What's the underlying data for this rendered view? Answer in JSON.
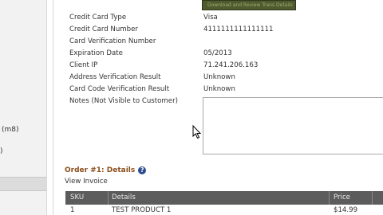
{
  "sidebar": {
    "items": [
      {
        "label": "(m8)"
      },
      {
        "label": ")"
      }
    ]
  },
  "top_banner": {
    "text": "Download and Review Trans Details"
  },
  "fields": [
    {
      "label": "Credit Card Type",
      "value": "Visa"
    },
    {
      "label": "Credit Card Number",
      "value": "4111111111111111"
    },
    {
      "label": "Card Verification Number",
      "value": ""
    },
    {
      "label": "Expiration Date",
      "value": "05/2013"
    },
    {
      "label": "Client IP",
      "value": "71.241.206.163"
    },
    {
      "label": "Address Verification Result",
      "value": "Unknown"
    },
    {
      "label": "Card Code Verification Result",
      "value": "Unknown"
    },
    {
      "label": "Notes (Not Visible to Customer)",
      "value": ""
    }
  ],
  "order": {
    "title": "Order #1: Details",
    "help_icon": "question-circle-icon",
    "view_invoice": "View Invoice"
  },
  "table": {
    "headers": [
      "SKU",
      "Details",
      "Price"
    ],
    "rows": [
      [
        "1",
        "TEST PRODUCT 1",
        "$14.99"
      ]
    ]
  },
  "colors": {
    "section_title": "#8a4f1c",
    "table_header_bg": "#5c5c5c",
    "help_icon": "#2c4e8f"
  }
}
